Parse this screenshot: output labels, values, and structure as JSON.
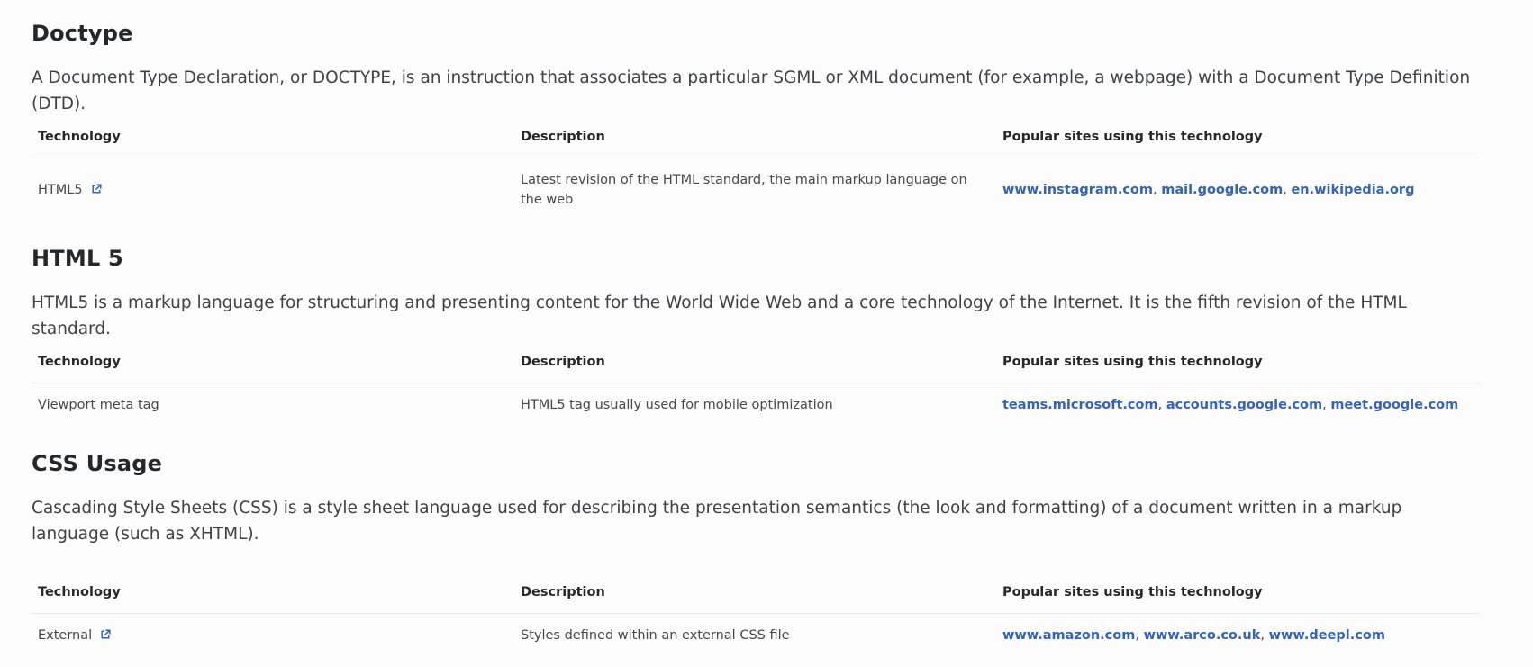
{
  "columns": {
    "technology": "Technology",
    "description": "Description",
    "sites": "Popular sites using this technology"
  },
  "colors": {
    "link": "#2f63c6",
    "heading": "#23282c",
    "text": "#3e4246"
  },
  "sections": [
    {
      "title": "Doctype",
      "description": "A Document Type Declaration, or DOCTYPE, is an instruction that associates a particular SGML or XML document (for example, a webpage) with a Document Type Definition (DTD).",
      "rows": [
        {
          "technology": "HTML5",
          "has_external_icon": true,
          "icon": "external-link-icon",
          "description": "Latest revision of the HTML standard, the main markup language on the web",
          "sites": [
            "www.instagram.com",
            "mail.google.com",
            "en.wikipedia.org"
          ]
        }
      ]
    },
    {
      "title": "HTML 5",
      "description": "HTML5 is a markup language for structuring and presenting content for the World Wide Web and a core technology of the Internet. It is the fifth revision of the HTML standard.",
      "rows": [
        {
          "technology": "Viewport meta tag",
          "has_external_icon": false,
          "description": "HTML5 tag usually used for mobile optimization",
          "sites": [
            "teams.microsoft.com",
            "accounts.google.com",
            "meet.google.com"
          ]
        }
      ]
    },
    {
      "title": "CSS Usage",
      "description": "Cascading Style Sheets (CSS) is a style sheet language used for describing the presentation semantics (the look and formatting) of a document written in a markup language (such as XHTML).",
      "rows": [
        {
          "technology": "External",
          "has_external_icon": true,
          "icon": "external-link-icon",
          "description": "Styles defined within an external CSS file",
          "sites": [
            "www.amazon.com",
            "www.arco.co.uk",
            "www.deepl.com"
          ]
        }
      ]
    }
  ]
}
